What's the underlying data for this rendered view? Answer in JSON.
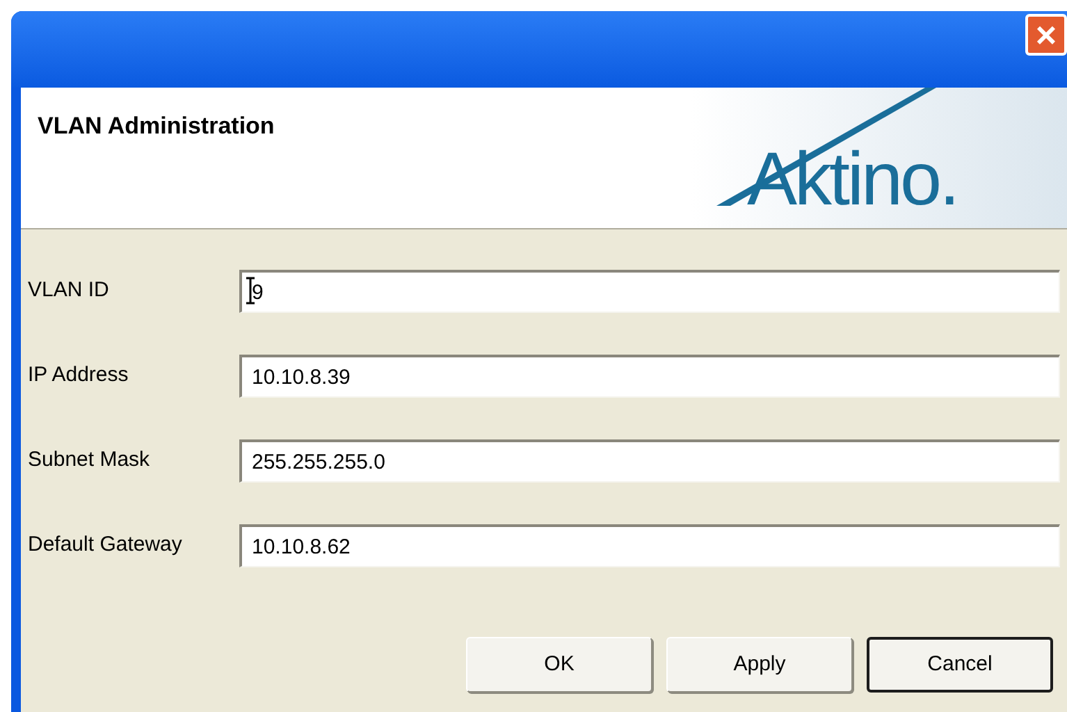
{
  "window": {
    "close_label": "×"
  },
  "header": {
    "title": "VLAN Administration",
    "logo": "Aktino."
  },
  "fields": [
    {
      "label": "VLAN ID",
      "value": "9",
      "cursor": true
    },
    {
      "label": "IP Address",
      "value": "10.10.8.39",
      "cursor": false
    },
    {
      "label": "Subnet Mask",
      "value": "255.255.255.0",
      "cursor": false
    },
    {
      "label": "Default Gateway",
      "value": "10.10.8.62",
      "cursor": false
    }
  ],
  "buttons": [
    {
      "label": "OK",
      "default": false
    },
    {
      "label": "Apply",
      "default": false
    },
    {
      "label": "Cancel",
      "default": true
    }
  ]
}
